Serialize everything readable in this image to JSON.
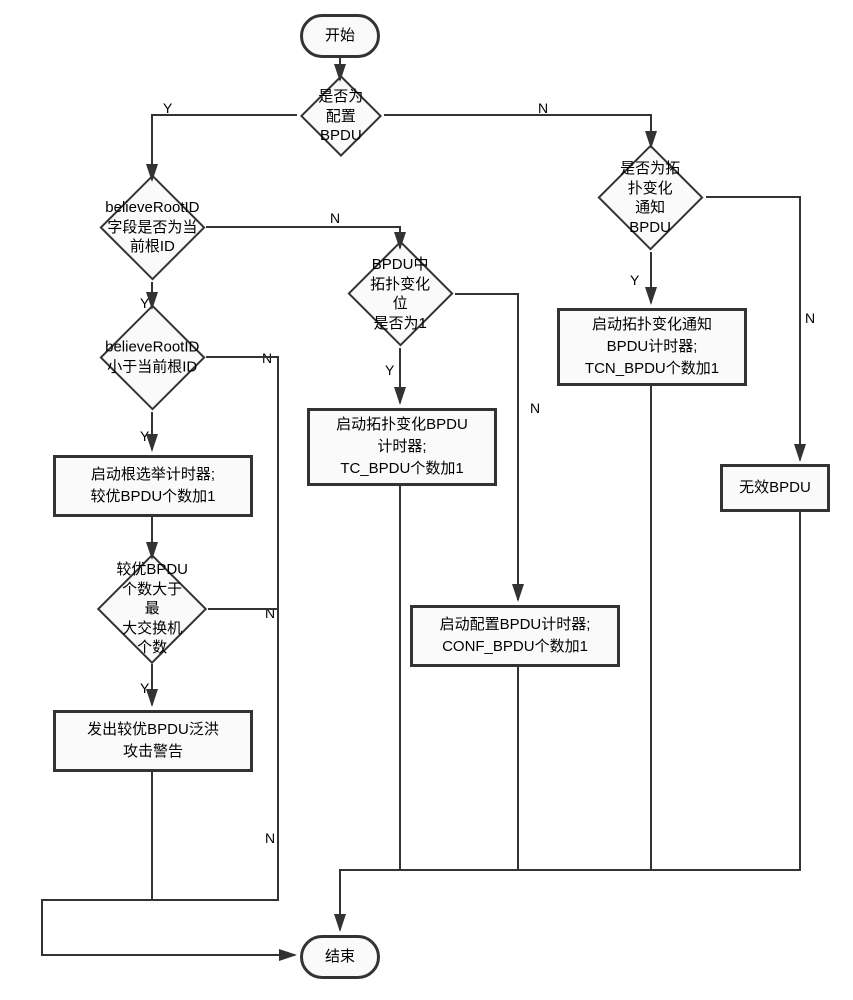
{
  "chart_data": {
    "type": "flowchart",
    "title": "BPDU处理流程图",
    "nodes": [
      {
        "id": "start",
        "type": "terminal",
        "label": "开始"
      },
      {
        "id": "d1",
        "type": "decision",
        "label": "是否为配置BPDU"
      },
      {
        "id": "d2",
        "type": "decision",
        "label": "believeRootID\n字段是否为当前根ID"
      },
      {
        "id": "d3",
        "type": "decision",
        "label": "believeRootID\n小于当前根ID"
      },
      {
        "id": "p1",
        "type": "process",
        "label": "启动根选举计时器;\n较优BPDU个数加1"
      },
      {
        "id": "d4",
        "type": "decision",
        "label": "较优BPDU个数大于最\n大交换机个数"
      },
      {
        "id": "p2",
        "type": "process",
        "label": "发出较优BPDU泛洪\n攻击警告"
      },
      {
        "id": "d5",
        "type": "decision",
        "label": "BPDU中拓扑变化位\n是否为1"
      },
      {
        "id": "p3",
        "type": "process",
        "label": "启动拓扑变化BPDU\n计时器;\nTC_BPDU个数加1"
      },
      {
        "id": "p4",
        "type": "process",
        "label": "启动配置BPDU计时器;\nCONF_BPDU个数加1"
      },
      {
        "id": "d6",
        "type": "decision",
        "label": "是否为拓扑变化\n通知BPDU"
      },
      {
        "id": "p5",
        "type": "process",
        "label": "启动拓扑变化通知\nBPDU计时器;\nTCN_BPDU个数加1"
      },
      {
        "id": "p6",
        "type": "process",
        "label": "无效BPDU"
      },
      {
        "id": "end",
        "type": "terminal",
        "label": "结束"
      }
    ],
    "edges": [
      {
        "from": "start",
        "to": "d1"
      },
      {
        "from": "d1",
        "to": "d2",
        "label": "Y"
      },
      {
        "from": "d1",
        "to": "d6",
        "label": "N"
      },
      {
        "from": "d2",
        "to": "d3",
        "label": "Y"
      },
      {
        "from": "d2",
        "to": "d5",
        "label": "N"
      },
      {
        "from": "d3",
        "to": "p1",
        "label": "Y"
      },
      {
        "from": "d3",
        "to": "end",
        "label": "N"
      },
      {
        "from": "p1",
        "to": "d4"
      },
      {
        "from": "d4",
        "to": "p2",
        "label": "Y"
      },
      {
        "from": "d4",
        "to": "end",
        "label": "N"
      },
      {
        "from": "p2",
        "to": "end"
      },
      {
        "from": "d5",
        "to": "p3",
        "label": "Y"
      },
      {
        "from": "d5",
        "to": "p4",
        "label": "N"
      },
      {
        "from": "p3",
        "to": "end"
      },
      {
        "from": "p4",
        "to": "end"
      },
      {
        "from": "d6",
        "to": "p5",
        "label": "Y"
      },
      {
        "from": "d6",
        "to": "p6",
        "label": "N"
      },
      {
        "from": "p5",
        "to": "end"
      },
      {
        "from": "p6",
        "to": "end"
      }
    ]
  },
  "labels": {
    "start": "开始",
    "end": "结束",
    "d1": "是否为配置BPDU",
    "d2a": "believeRootID",
    "d2b": "字段是否为当前根ID",
    "d3a": "believeRootID",
    "d3b": "小于当前根ID",
    "p1a": "启动根选举计时器;",
    "p1b": "较优BPDU个数加1",
    "d4a": "较优BPDU个数大于最",
    "d4b": "大交换机个数",
    "p2a": "发出较优BPDU泛洪",
    "p2b": "攻击警告",
    "d5a": "BPDU中拓扑变化位",
    "d5b": "是否为1",
    "p3a": "启动拓扑变化BPDU",
    "p3b": "计时器;",
    "p3c": "TC_BPDU个数加1",
    "p4a": "启动配置BPDU计时器;",
    "p4b": "CONF_BPDU个数加1",
    "d6a": "是否为拓扑变化",
    "d6b": "通知BPDU",
    "p5a": "启动拓扑变化通知",
    "p5b": "BPDU计时器;",
    "p5c": "TCN_BPDU个数加1",
    "p6": "无效BPDU",
    "Y": "Y",
    "N": "N"
  }
}
